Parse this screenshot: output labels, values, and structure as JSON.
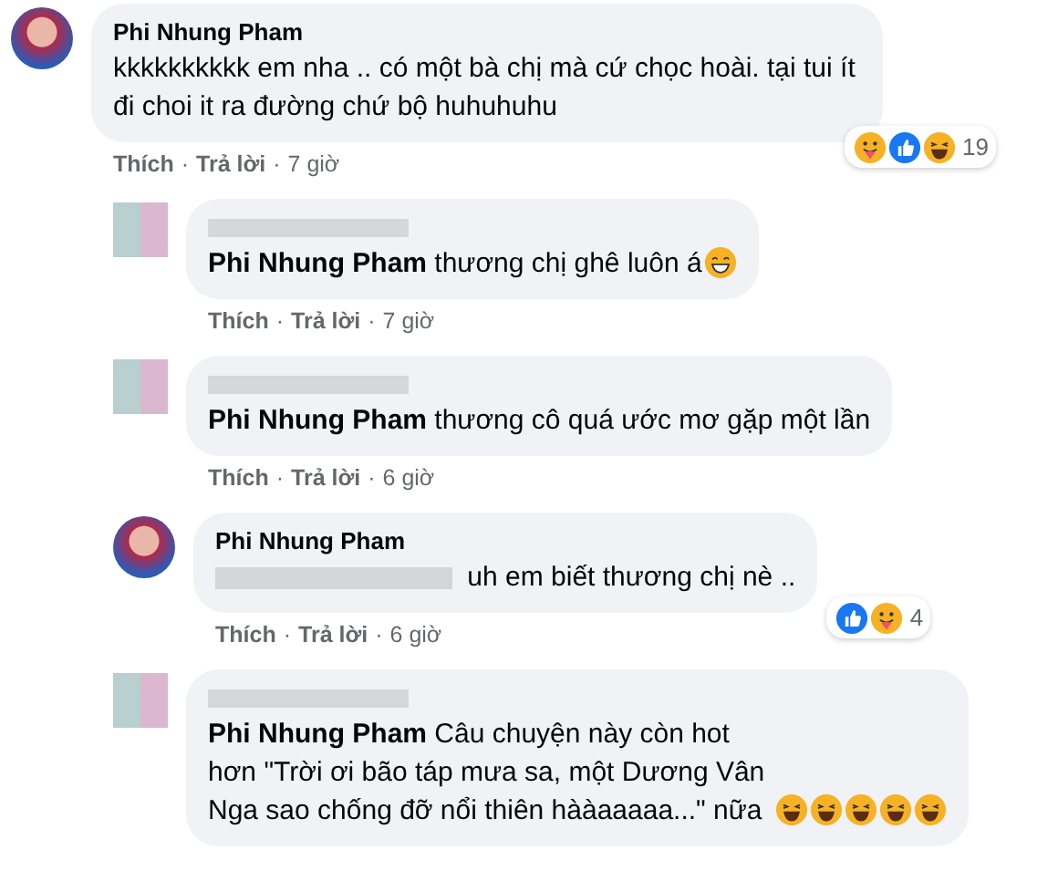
{
  "comments": [
    {
      "author": "Phi Nhung Pham",
      "text": "kkkkkkkkkk em nha .. có một bà chị mà cứ chọc hoài. tại tui ít đi choi it ra đường chứ bộ huhuhuhu",
      "actions": [
        {
          "kind": "link",
          "label": "Thích"
        },
        {
          "kind": "separator",
          "label": "·"
        },
        {
          "kind": "link",
          "label": "Trả lời"
        },
        {
          "kind": "separator",
          "label": "·"
        },
        {
          "kind": "time",
          "label": "7 giờ"
        }
      ],
      "reactions": {
        "icons": [
          {
            "kind": "care"
          },
          {
            "kind": "like"
          },
          {
            "kind": "haha"
          }
        ],
        "count": "19"
      },
      "replies": [
        {
          "text": "**Phi Nhung Pham** thương chị ghê luôn á",
          "emojis": [
            {
              "kind": "smile"
            }
          ],
          "actions": [
            {
              "kind": "link",
              "label": "Thích"
            },
            {
              "kind": "separator",
              "label": "·"
            },
            {
              "kind": "link",
              "label": "Trả lời"
            },
            {
              "kind": "separator",
              "label": "·"
            },
            {
              "kind": "time",
              "label": "7 giờ"
            }
          ]
        },
        {
          "text": "**Phi Nhung Pham** thương cô quá ước mơ gặp một lần",
          "actions": [
            {
              "kind": "link",
              "label": "Thích"
            },
            {
              "kind": "separator",
              "label": "·"
            },
            {
              "kind": "link",
              "label": "Trả lời"
            },
            {
              "kind": "separator",
              "label": "·"
            },
            {
              "kind": "time",
              "label": "6 giờ"
            }
          ]
        },
        {
          "author": "Phi Nhung Pham",
          "mention_blurred": true,
          "text": "uh em biết thương chị nè ..",
          "actions": [
            {
              "kind": "link",
              "label": "Thích"
            },
            {
              "kind": "separator",
              "label": "·"
            },
            {
              "kind": "link",
              "label": "Trả lời"
            },
            {
              "kind": "separator",
              "label": "·"
            },
            {
              "kind": "time",
              "label": "6 giờ"
            }
          ],
          "reactions": {
            "icons": [
              {
                "kind": "like"
              },
              {
                "kind": "care"
              }
            ],
            "count": "4"
          }
        },
        {
          "text": "**Phi Nhung Pham** Câu chuyện này còn hot hơn \"Trời ơi bão táp mưa sa, một Dương Vân Nga sao chống đỡ nổi thiên hààaaaaa...\" nữa",
          "emojis": [
            {
              "kind": "laugh"
            },
            {
              "kind": "laugh"
            },
            {
              "kind": "laugh"
            },
            {
              "kind": "laugh"
            },
            {
              "kind": "laugh"
            }
          ]
        }
      ]
    }
  ]
}
